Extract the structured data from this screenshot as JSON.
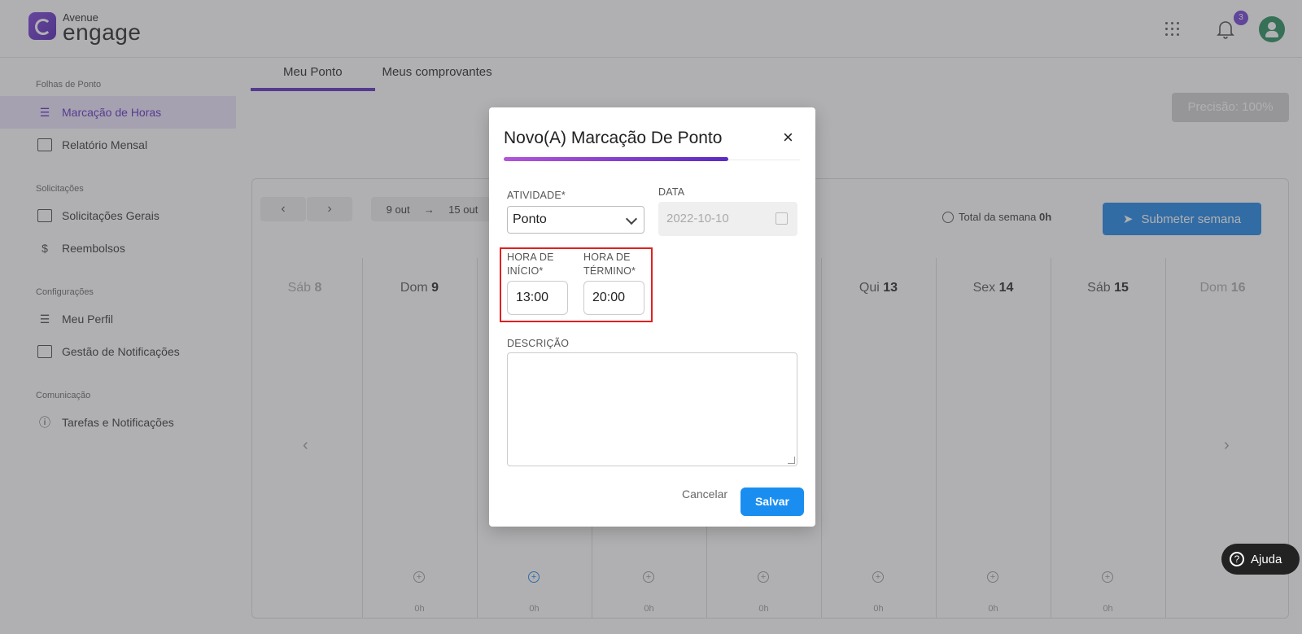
{
  "brand": {
    "small": "Avenue",
    "big": "engage"
  },
  "header": {
    "notifications_count": "3"
  },
  "sidebar": {
    "sections": [
      {
        "title": "Folhas de Ponto",
        "items": [
          "Marcação de Horas",
          "Relatório Mensal"
        ]
      },
      {
        "title": "Solicitações",
        "items": [
          "Solicitações Gerais",
          "Reembolsos"
        ]
      },
      {
        "title": "Configurações",
        "items": [
          "Meu Perfil",
          "Gestão de Notificações"
        ]
      },
      {
        "title": "Comunicação",
        "items": [
          "Tarefas e Notificações"
        ]
      }
    ],
    "active_item": "Marcação de Horas"
  },
  "tabs": [
    "Meu Ponto",
    "Meus comprovantes"
  ],
  "precision": "Precisão: 100%",
  "calendar": {
    "range_start": "9 out",
    "range_end": "15 out",
    "total_label": "Total da semana",
    "total_value": "0h",
    "submit_label": "Submeter semana",
    "days": [
      {
        "name": "Sáb",
        "num": "8"
      },
      {
        "name": "Dom",
        "num": "9"
      },
      {
        "name": "Qui",
        "num": "13"
      },
      {
        "name": "Sex",
        "num": "14"
      },
      {
        "name": "Sáb",
        "num": "15"
      },
      {
        "name": "Dom",
        "num": "16"
      }
    ],
    "day_hours": "0h"
  },
  "help_label": "Ajuda",
  "modal": {
    "title": "Novo(A) Marcação De Ponto",
    "activity_label": "ATIVIDADE*",
    "activity_value": "Ponto",
    "date_label": "DATA",
    "date_value": "2022-10-10",
    "start_label_1": "HORA DE",
    "start_label_2": "INÍCIO*",
    "start_value": "13:00",
    "end_label_1": "HORA DE",
    "end_label_2": "TÉRMINO*",
    "end_value": "20:00",
    "description_label": "DESCRIÇÃO",
    "cancel_label": "Cancelar",
    "save_label": "Salvar"
  }
}
